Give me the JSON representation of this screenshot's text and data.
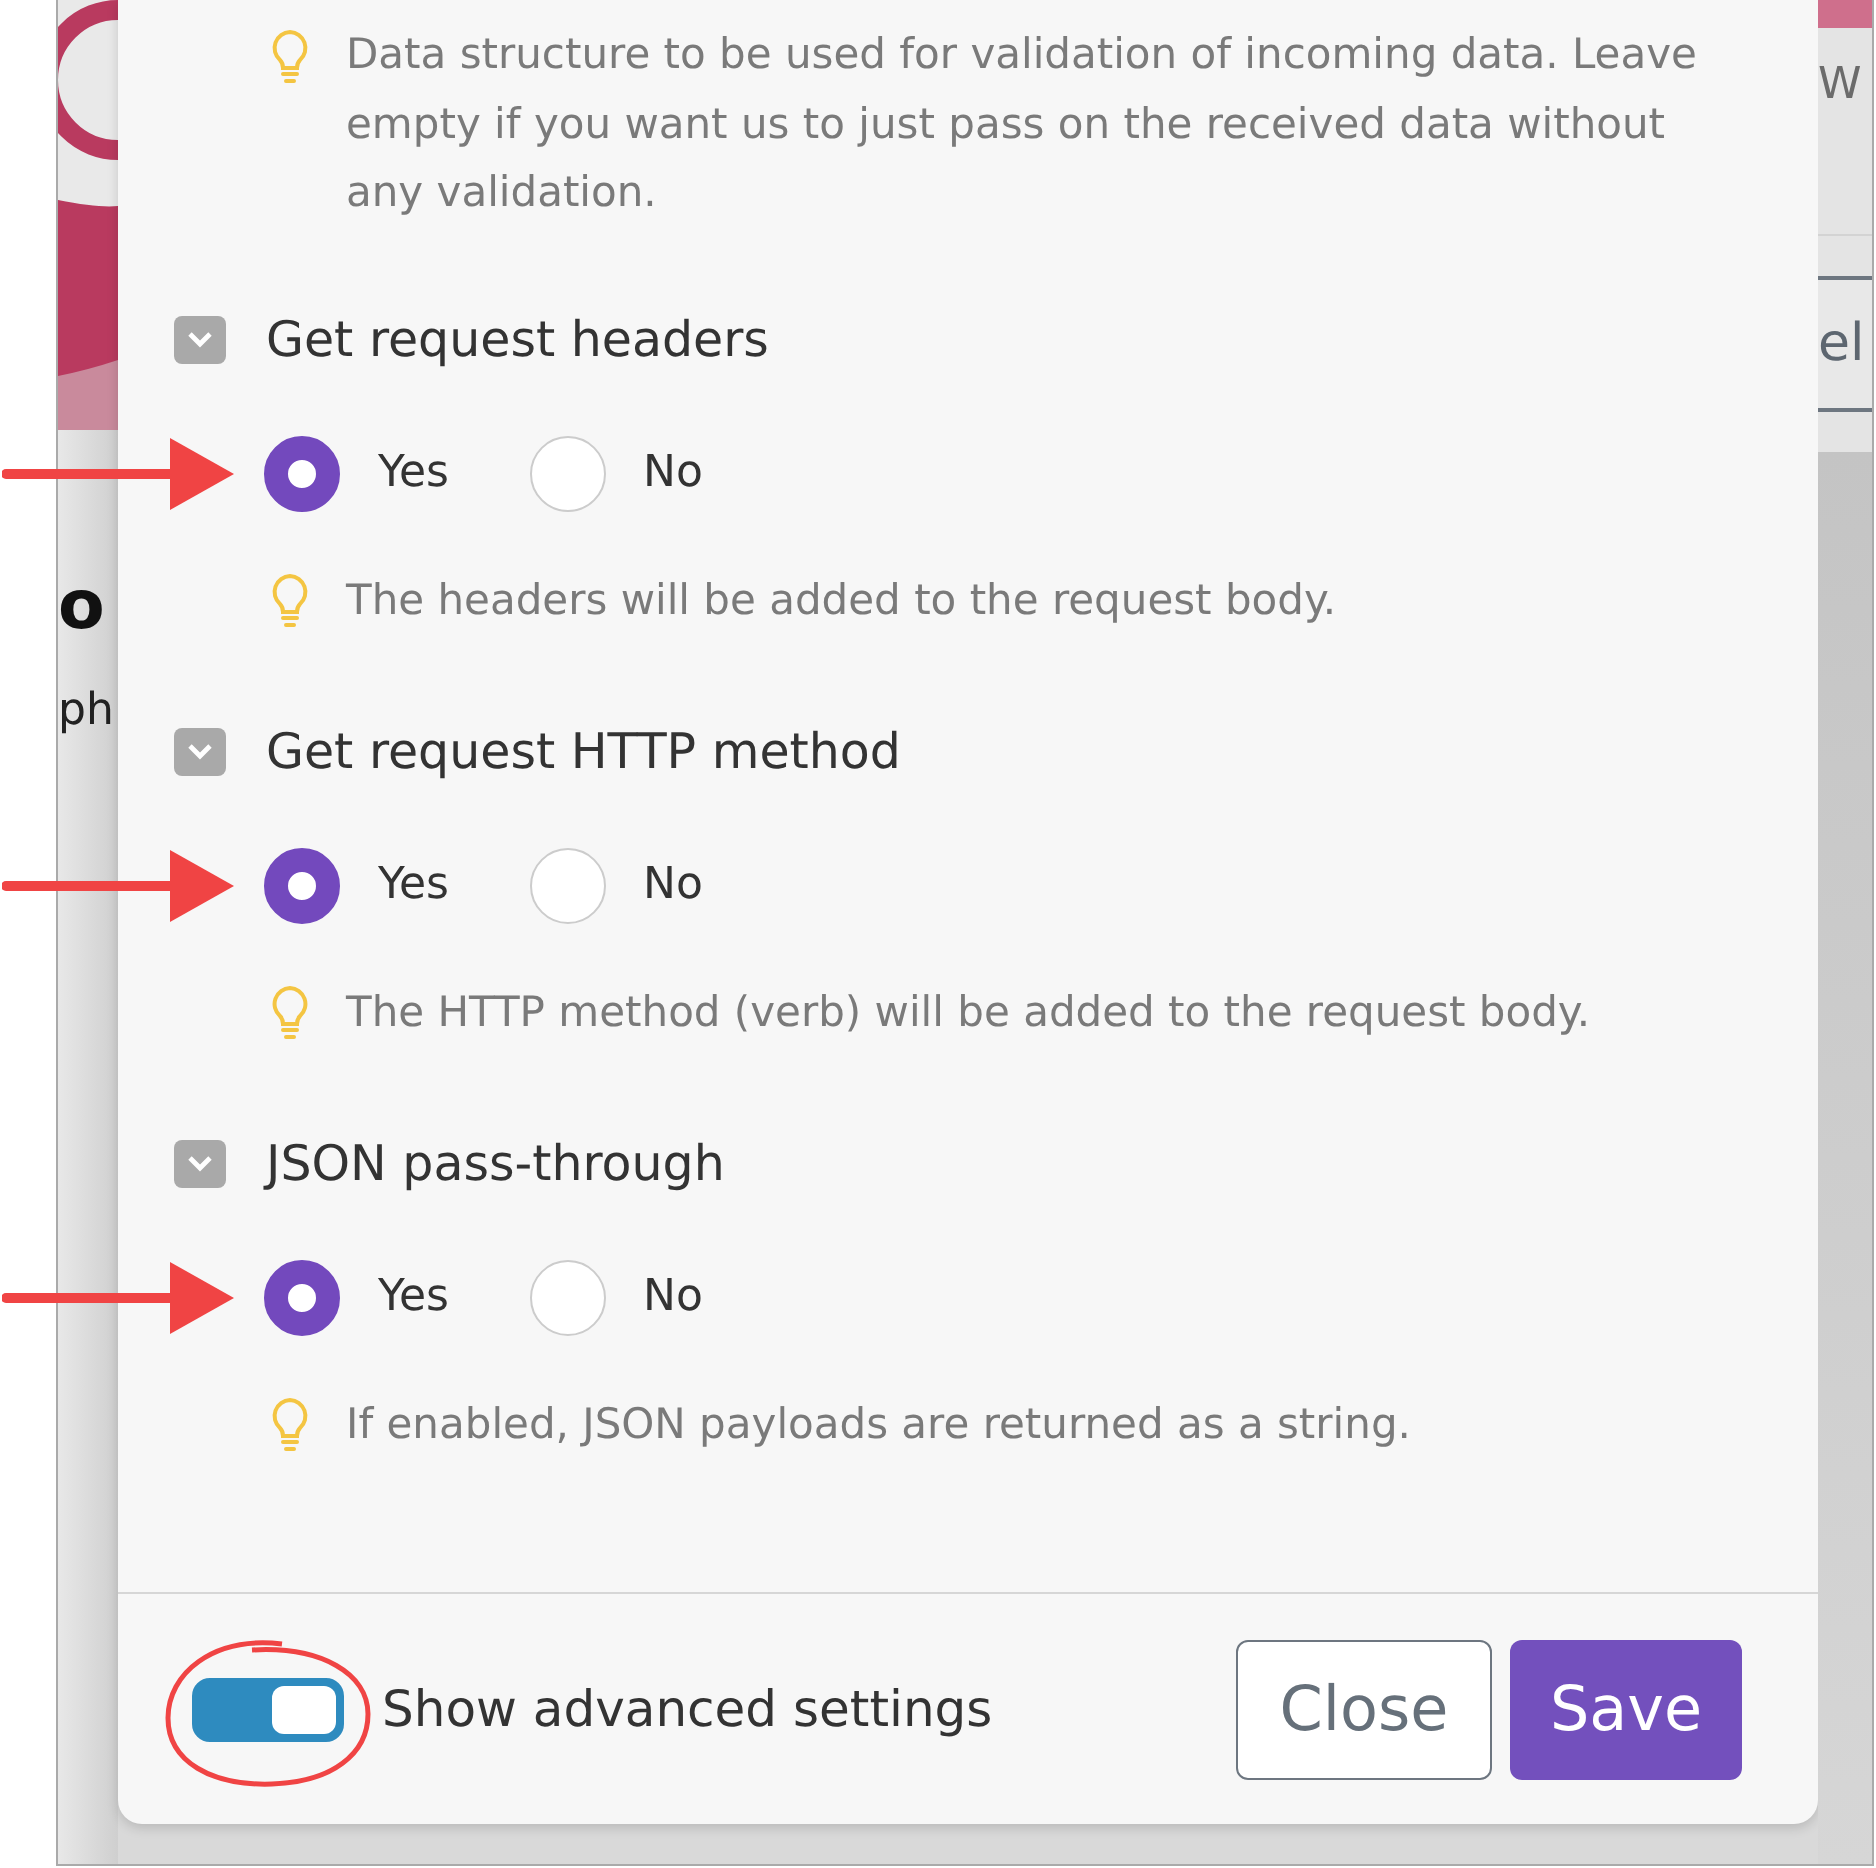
{
  "background": {
    "left_texts": [
      "o",
      "ph"
    ],
    "right_texts": [
      "W",
      "el"
    ]
  },
  "dialog": {
    "intro_hint": "Data structure to be used for validation of incoming data. Leave empty if you want us to just pass on the received data without any validation.",
    "sections": [
      {
        "label": "Get request headers",
        "options": [
          {
            "label": "Yes",
            "selected": true
          },
          {
            "label": "No",
            "selected": false
          }
        ],
        "hint": "The headers will be added to the request body.",
        "annotated": true
      },
      {
        "label": "Get request HTTP method",
        "options": [
          {
            "label": "Yes",
            "selected": true
          },
          {
            "label": "No",
            "selected": false
          }
        ],
        "hint": "The HTTP method (verb) will be added to the request body.",
        "annotated": true
      },
      {
        "label": "JSON pass-through",
        "options": [
          {
            "label": "Yes",
            "selected": true
          },
          {
            "label": "No",
            "selected": false
          }
        ],
        "hint": "If enabled, JSON payloads are returned as a string.",
        "annotated": true
      }
    ],
    "footer": {
      "toggle": {
        "label": "Show advanced settings",
        "on": true,
        "annotated": true
      },
      "buttons": [
        {
          "label": "Close",
          "kind": "secondary"
        },
        {
          "label": "Save",
          "kind": "primary"
        }
      ]
    }
  }
}
